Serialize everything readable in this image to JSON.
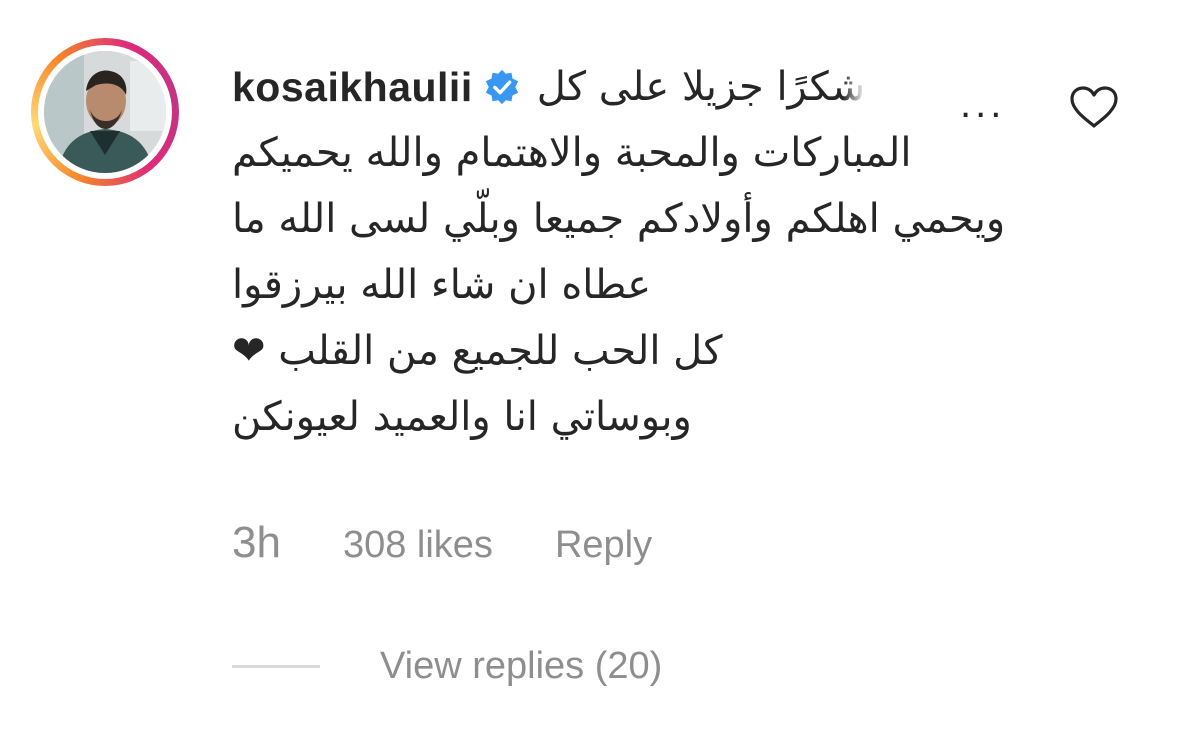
{
  "comment": {
    "username": "kosaikhaulii",
    "verified_icon": "verified-badge-icon",
    "verified_color": "#3897f0",
    "avatar_ring_colors": [
      "#f58529",
      "#dd2a7b",
      "#c13584"
    ],
    "text_first_line": "شكرًا جزيلا على كل",
    "text_lines": [
      "المباركات والمحبة والاهتمام والله يحميكم",
      "ويحمي اهلكم وأولادكم جميعا وبلّي لسى الله ما",
      "عطاه ان شاء الله بيرزقوا ",
      "كل الحب للجميع من القلب ❤",
      "وبوساتي انا والعميد لعيونكن "
    ],
    "more_label": "...",
    "like_icon": "heart-outline-icon"
  },
  "meta": {
    "time": "3h",
    "likes": "308 likes",
    "reply": "Reply"
  },
  "replies": {
    "label": "View replies (20)"
  }
}
